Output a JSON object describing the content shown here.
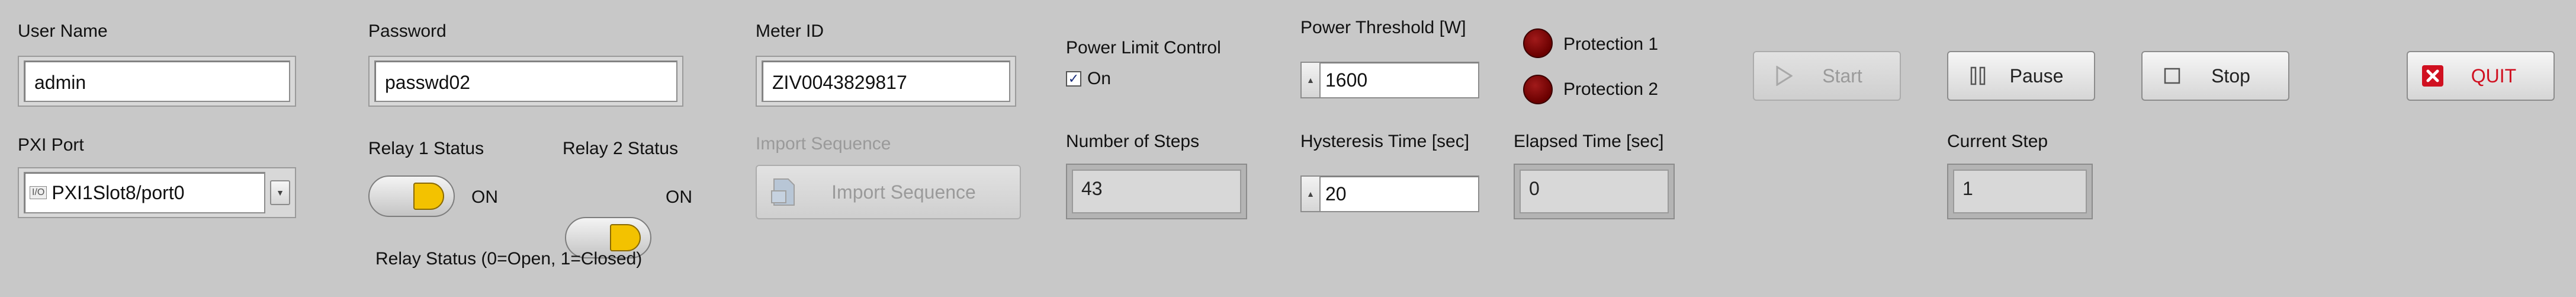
{
  "login": {
    "username_label": "User Name",
    "username_value": "admin",
    "password_label": "Password",
    "password_value": "passwd02",
    "meter_id_label": "Meter ID",
    "meter_id_value": "ZIV0043829817"
  },
  "pxi": {
    "port_label": "PXI Port",
    "port_value": "PXI1Slot8/port0",
    "port_prefix_glyph": "I/O"
  },
  "relays": {
    "relay1_label": "Relay 1 Status",
    "relay1_state": "ON",
    "relay2_label": "Relay 2 Status",
    "relay2_state": "ON",
    "legend": "Relay Status (0=Open, 1=Closed)"
  },
  "sequence": {
    "label": "Import Sequence",
    "button_label": "Import Sequence"
  },
  "power_limit": {
    "label": "Power Limit Control",
    "checkbox_label": "On",
    "checked": true
  },
  "steps": {
    "number_label": "Number of Steps",
    "number_value": "43",
    "current_label": "Current Step",
    "current_value": "1"
  },
  "threshold": {
    "label": "Power Threshold [W]",
    "value": "1600"
  },
  "hysteresis": {
    "label": "Hysteresis Time [sec]",
    "value": "20"
  },
  "elapsed": {
    "label": "Elapsed Time [sec]",
    "value": "0"
  },
  "protection": {
    "p1_label": "Protection 1",
    "p2_label": "Protection 2",
    "led_color": "#7a0000"
  },
  "controls": {
    "start_label": "Start",
    "pause_label": "Pause",
    "stop_label": "Stop",
    "quit_label": "QUIT",
    "quit_color": "#d01020"
  }
}
